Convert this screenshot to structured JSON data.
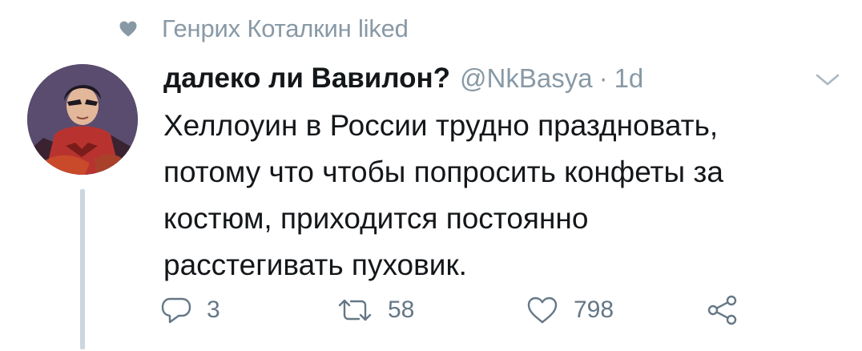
{
  "social_context": {
    "icon": "heart-icon",
    "text": "Генрих Коталкин liked"
  },
  "tweet": {
    "author_name": "далеко ли Вавилон?",
    "handle": "@NkBasya",
    "separator": "·",
    "time": "1d",
    "text_lines": [
      "Хеллоуин в России трудно праздновать,",
      "потому что чтобы попросить конфеты за",
      "костюм, приходится постоянно",
      "расстегивать пуховик."
    ]
  },
  "actions": {
    "reply_count": "3",
    "retweet_count": "58",
    "like_count": "798"
  },
  "colors": {
    "secondary_text": "#8899a6",
    "primary_text": "#14171a",
    "icon_gray": "#657786",
    "thread_line": "#ccd6dd"
  }
}
